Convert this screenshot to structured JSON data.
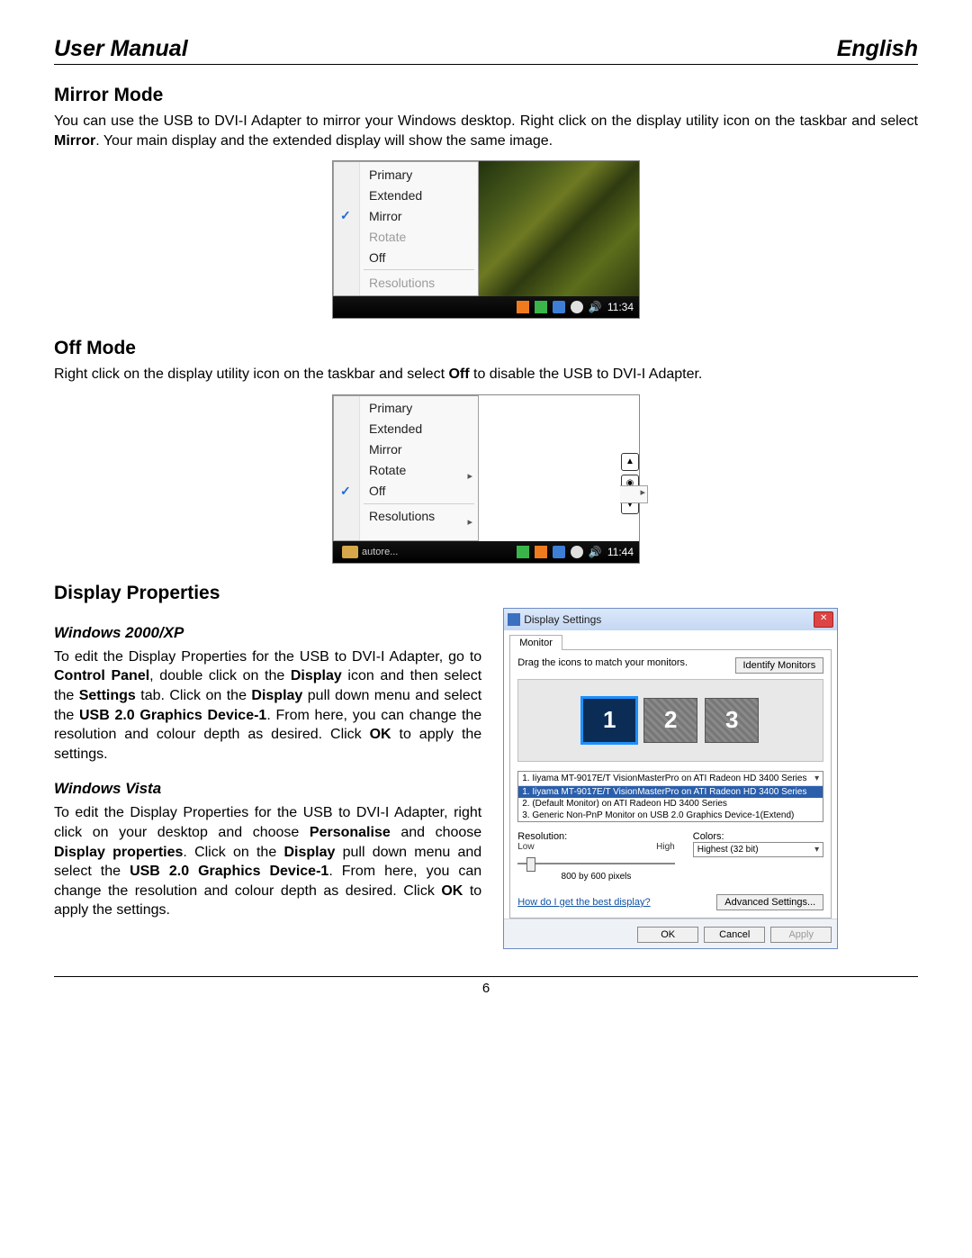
{
  "header": {
    "title": "User Manual",
    "lang": "English"
  },
  "page_number": "6",
  "sec_mirror": {
    "heading": "Mirror Mode",
    "p1a": "You can use the USB to DVI-I Adapter to mirror your Windows desktop. Right click on the display utility icon on the taskbar and select ",
    "p1b": "Mirror",
    "p1c": ". Your main display and the extended display will show the same image."
  },
  "menu1": {
    "items": {
      "primary": "Primary",
      "extended": "Extended",
      "mirror": "Mirror",
      "rotate": "Rotate",
      "off": "Off",
      "resolutions": "Resolutions"
    },
    "checked": "mirror",
    "clock": "11:34"
  },
  "sec_off": {
    "heading": "Off Mode",
    "p1a": "Right click on the display utility icon on the taskbar and select ",
    "p1b": "Off",
    "p1c": " to disable the USB to DVI-I Adapter."
  },
  "menu2": {
    "items": {
      "primary": "Primary",
      "extended": "Extended",
      "mirror": "Mirror",
      "rotate": "Rotate",
      "off": "Off",
      "resolutions": "Resolutions"
    },
    "checked": "off",
    "taskbtn": "autore...",
    "clock": "11:44"
  },
  "sec_dp": {
    "heading": "Display Properties",
    "sub1": "Windows 2000/XP",
    "sub2": "Windows Vista",
    "p2000_1": "To edit the Display Properties for the USB to DVI-I Adapter, go to ",
    "p2000_2": "Control Panel",
    "p2000_3": ", double click on the ",
    "p2000_4": "Display",
    "p2000_5": " icon and then select the ",
    "p2000_6": "Settings",
    "p2000_7": " tab. Click on the ",
    "p2000_8": "Display",
    "p2000_9": " pull down menu and select the ",
    "p2000_10": "USB 2.0 Graphics Device-1",
    "p2000_11": ". From here, you can change the resolution and colour depth as desired. Click ",
    "p2000_12": "OK",
    "p2000_13": " to apply the settings.",
    "pVista_1": "To edit the Display Properties for the USB to DVI-I Adapter, right click on your desktop and choose ",
    "pVista_2": "Personalise",
    "pVista_3": " and choose ",
    "pVista_4": "Display properties",
    "pVista_5": ". Click on the ",
    "pVista_6": "Display",
    "pVista_7": " pull down menu and select the ",
    "pVista_8": "USB 2.0 Graphics Device-1",
    "pVista_9": ". From here, you can change the resolution and colour depth as desired. Click ",
    "pVista_10": "OK",
    "pVista_11": " to apply the settings."
  },
  "dlg": {
    "title": "Display Settings",
    "tab": "Monitor",
    "hint": "Drag the icons to match your monitors.",
    "identify": "Identify Monitors",
    "mon1": "1",
    "mon2": "2",
    "mon3": "3",
    "drop_sel": "1. Iiyama MT-9017E/T VisionMasterPro on ATI Radeon HD 3400 Series",
    "drop_o1": "1. Iiyama MT-9017E/T VisionMasterPro on ATI Radeon HD 3400 Series",
    "drop_o2": "2. (Default Monitor) on ATI Radeon HD 3400 Series",
    "drop_o3": "3. Generic Non-PnP Monitor on USB 2.0 Graphics Device-1(Extend)",
    "res_label": "Resolution:",
    "res_low": "Low",
    "res_high": "High",
    "res_current": "800 by 600 pixels",
    "col_label": "Colors:",
    "col_value": "Highest (32 bit)",
    "helplink": "How do I get the best display?",
    "adv": "Advanced Settings...",
    "ok": "OK",
    "cancel": "Cancel",
    "apply": "Apply"
  }
}
